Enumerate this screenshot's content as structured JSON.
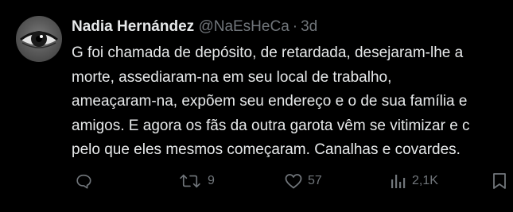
{
  "author": {
    "name": "Nadia Hernández",
    "handle": "@NaEsHeCa",
    "separator": "·",
    "time": "3d"
  },
  "tweet": {
    "lines": [
      "G foi chamada de depósito, de retardada, desejaram-lhe a",
      "morte, assediaram-na em seu local de trabalho,",
      "ameaçaram-na, expõem seu endereço e o de sua família e",
      "amigos. E agora os fãs da outra garota vêm se vitimizar e c",
      "pelo que eles mesmos começaram. Canalhas e covardes."
    ]
  },
  "actions": {
    "reply": {
      "icon": "reply-icon",
      "count": ""
    },
    "retweet": {
      "icon": "retweet-icon",
      "count": "9"
    },
    "like": {
      "icon": "heart-icon",
      "count": "57"
    },
    "views": {
      "icon": "views-bar-chart-icon",
      "count": "2,1K"
    },
    "bookmark": {
      "icon": "bookmark-icon",
      "count": ""
    }
  },
  "colors": {
    "background": "#000000",
    "primary_text": "#e7e9ea",
    "secondary_text": "#71767b"
  }
}
